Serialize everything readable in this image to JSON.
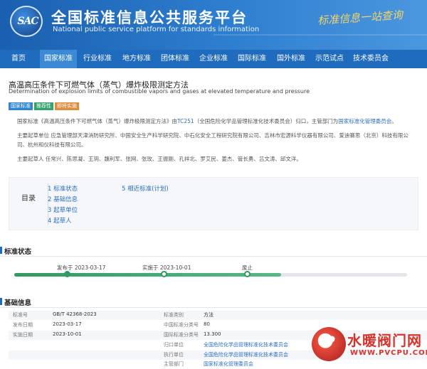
{
  "header": {
    "logo": "SAC",
    "title_cn": "全国标准信息公共服务平台",
    "title_en": "National public service platform  for standards information",
    "slogan": "标准信息一站查询"
  },
  "nav": [
    {
      "label": "首页"
    },
    {
      "label": "国家标准",
      "active": true
    },
    {
      "label": "行业标准"
    },
    {
      "label": "地方标准"
    },
    {
      "label": "团体标准"
    },
    {
      "label": "企业标准"
    },
    {
      "label": "国际标准"
    },
    {
      "label": "国外标准"
    },
    {
      "label": "示范试点"
    },
    {
      "label": "技术委员会"
    }
  ],
  "standard": {
    "title_cn": "高温高压条件下可燃气体（蒸气）爆炸极限测定方法",
    "title_en": "Determination of explosion limits of combustible vapors and gases at elevated temperature and pressure",
    "badges": [
      "国家标准",
      "推荐性",
      "即将实施"
    ]
  },
  "intro": {
    "p1_prefix": "国家标准《高温高压条件下可燃气体（蒸气）爆炸极限测定方法》由",
    "p1_tc": "TC251",
    "p1_mid": "（全国危险化学品管理标准化技术委员会）归口，主管部门为",
    "p1_dept": "国家标准化管理委员会",
    "p1_suffix": "。",
    "p2": "主要起草单位 应急管理部天津消防研究所、中国安全生产科学研究院、中石化安全工程研究院有限公司、吉林市宏源科学仪器有限公司、爱迪赛思（北京）科技有限公司、杭州和仪科技有限公司。",
    "p3": "主要起草人 任常兴、陈思凝、王玥、魏利军、张网、张玫、王振刚、孔祥北、罗艾民、姜杰、管长勇、吕文涛、邱文洋。"
  },
  "toc": {
    "title": "目录",
    "items": [
      "1  标准状态",
      "2  基础信息",
      "3  起草单位",
      "4  起草人",
      "5  相近标准(计划)"
    ]
  },
  "status_section": {
    "title": "标准状态",
    "published_label": "发布于 2023-03-17",
    "implemented_label": "实施于 2023-10-01",
    "abolished_label": "废止",
    "progress": 0.68
  },
  "basic_section": {
    "title": "基础信息",
    "left": [
      {
        "label": "标准号",
        "value": "GB/T 42368-2023"
      },
      {
        "label": "发布日期",
        "value": "2023-03-17"
      },
      {
        "label": "实施日期",
        "value": "2023-10-01"
      }
    ],
    "right": [
      {
        "label": "标准类别",
        "value": "方法"
      },
      {
        "label": "中国标准分类号",
        "value": "80"
      },
      {
        "label": "国际标准分类号",
        "value": "13.300"
      },
      {
        "label": "归口单位",
        "value": "全国危险化学品管理标准化技术委员会",
        "link": true
      },
      {
        "label": "执行单位",
        "value": "全国危险化学品管理标准化技术委员会",
        "link": true
      },
      {
        "label": "主管部门",
        "value": "国家标准化管理委员会",
        "link": true
      }
    ]
  },
  "watermark": {
    "cn": "水暖阀门网",
    "en": "WWW.PVCPU.COM"
  },
  "colors": {
    "header_blue": "#1f6bbd",
    "link_blue": "#2a6fc0",
    "status_green": "#2f9a62"
  }
}
